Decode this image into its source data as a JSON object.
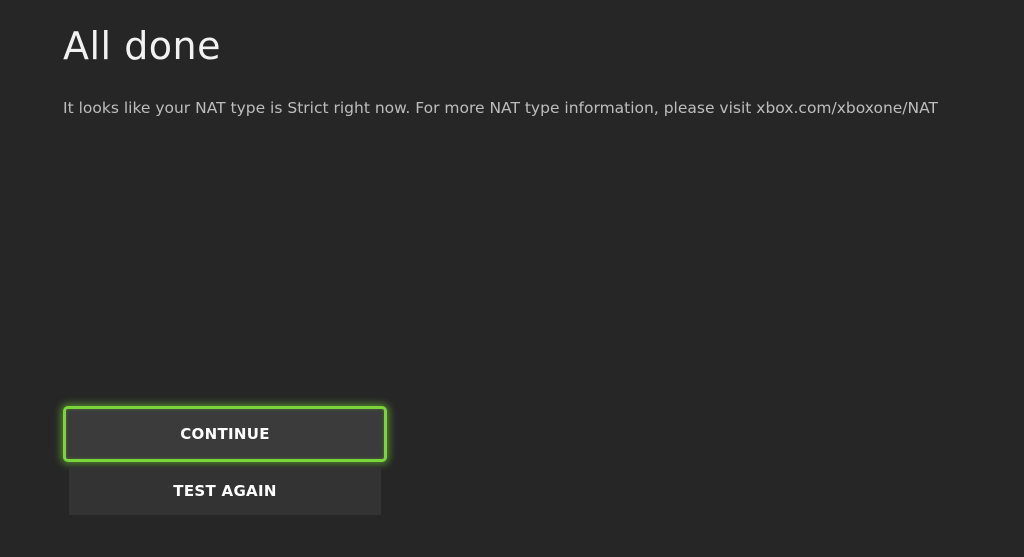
{
  "page": {
    "title": "All done",
    "message": "It looks like your NAT type is Strict right now. For more NAT type information, please visit xbox.com/xboxone/NAT"
  },
  "buttons": {
    "continue_label": "CONTINUE",
    "test_again_label": "TEST AGAIN"
  },
  "theme": {
    "background": "#262626",
    "focus_accent": "#7ad53a",
    "button_bg": "#333333"
  }
}
